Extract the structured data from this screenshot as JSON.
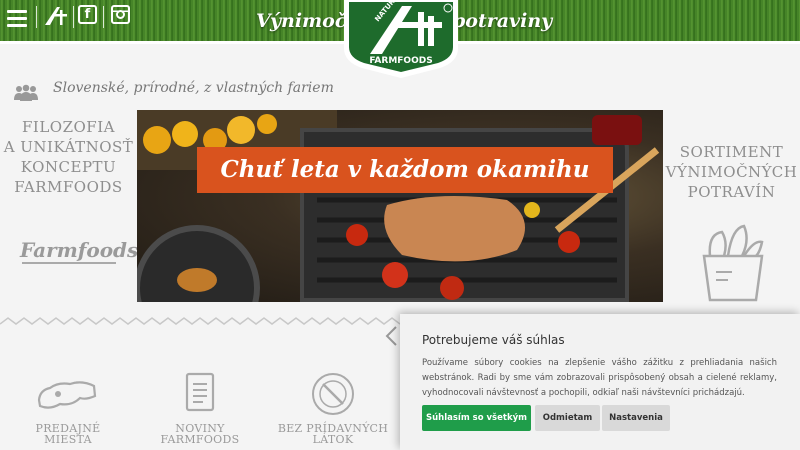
{
  "header": {
    "slogan_left": "Výnimočné",
    "slogan_right": "potraviny",
    "logo_top_text": "NATUR",
    "logo_bottom_text": "FARMFOODS",
    "facebook_label": "f"
  },
  "tagline": "Slovenské, prírodné, z vlastných fariem",
  "left_panel": {
    "lines": [
      "FILOZOFIA",
      "A UNIKÁTNOSŤ",
      "KONCEPTU",
      "FARMFOODS"
    ],
    "brand": "Farmfoods"
  },
  "right_panel": {
    "lines": [
      "SORTIMENT",
      "VÝNIMOČNÝCH",
      "POTRAVÍN"
    ]
  },
  "hero": {
    "banner": "Chuť leta v každom okamihu"
  },
  "bottom": {
    "items": [
      {
        "line1": "PREDAJNÉ",
        "line2": "MIESTA"
      },
      {
        "line1": "NOVINY",
        "line2": "FARMFOODS"
      },
      {
        "line1": "BEZ PRÍDAVNÝCH",
        "line2": "LÁTOK"
      }
    ]
  },
  "cookie": {
    "title": "Potrebujeme váš súhlas",
    "text": "Používame súbory cookies na zlepšenie vášho zážitku z prehliadania našich webstránok. Radi by sme vám zobrazovali prispôsobený obsah a cielené reklamy, vyhodnocovali návštevnosť a pochopili, odkiaľ naši návštevníci prichádzajú.",
    "accept": "Súhlasím so všetkým",
    "reject": "Odmietam",
    "settings": "Nastavenia"
  },
  "colors": {
    "accent_orange": "#d9531e",
    "accept_green": "#1f9d4a",
    "logo_green": "#1e6b2c"
  }
}
